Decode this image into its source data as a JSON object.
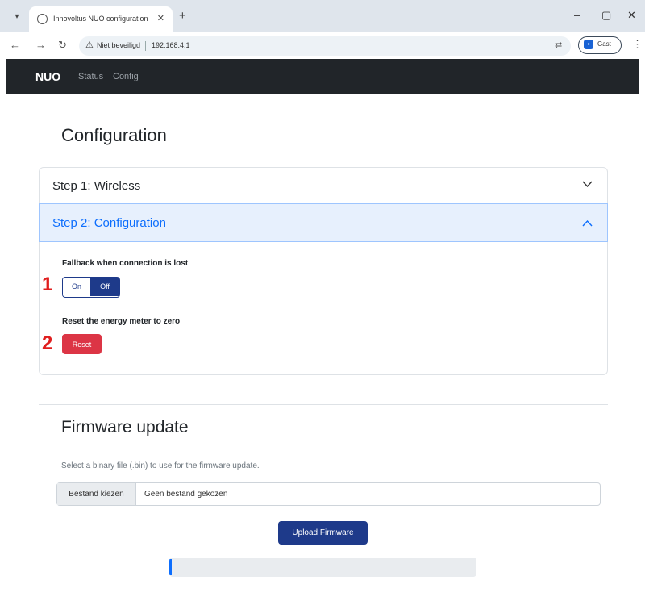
{
  "browser": {
    "tab_title": "Innovoltus NUO configuration",
    "tab_close": "✕",
    "new_tab": "+",
    "minimize": "–",
    "maximize": "▢",
    "close": "✕",
    "security_label": "Niet beveiligd",
    "url": "192.168.4.1",
    "profile_label": "Gast"
  },
  "navbar": {
    "brand": "NUO",
    "links": [
      "Status",
      "Config"
    ]
  },
  "main": {
    "title": "Configuration",
    "accordion": [
      {
        "label": "Step 1: Wireless",
        "expanded": false
      },
      {
        "label": "Step 2: Configuration",
        "expanded": true
      }
    ],
    "fallback": {
      "label": "Fallback when connection is lost",
      "on_label": "On",
      "off_label": "Off",
      "selected": "Off"
    },
    "reset": {
      "label": "Reset the energy meter to zero",
      "button": "Reset"
    },
    "markers": [
      "1",
      "2"
    ]
  },
  "firmware": {
    "title": "Firmware update",
    "help": "Select a binary file (.bin) to use for the firmware update.",
    "file_button": "Bestand kiezen",
    "file_name": "Geen bestand gekozen",
    "upload_button": "Upload Firmware",
    "progress": 0
  },
  "colors": {
    "navbar": "#212529",
    "primary": "#0d6efd",
    "dark_blue": "#1e3a8a",
    "danger": "#dc3545",
    "marker": "#e01e1e"
  }
}
